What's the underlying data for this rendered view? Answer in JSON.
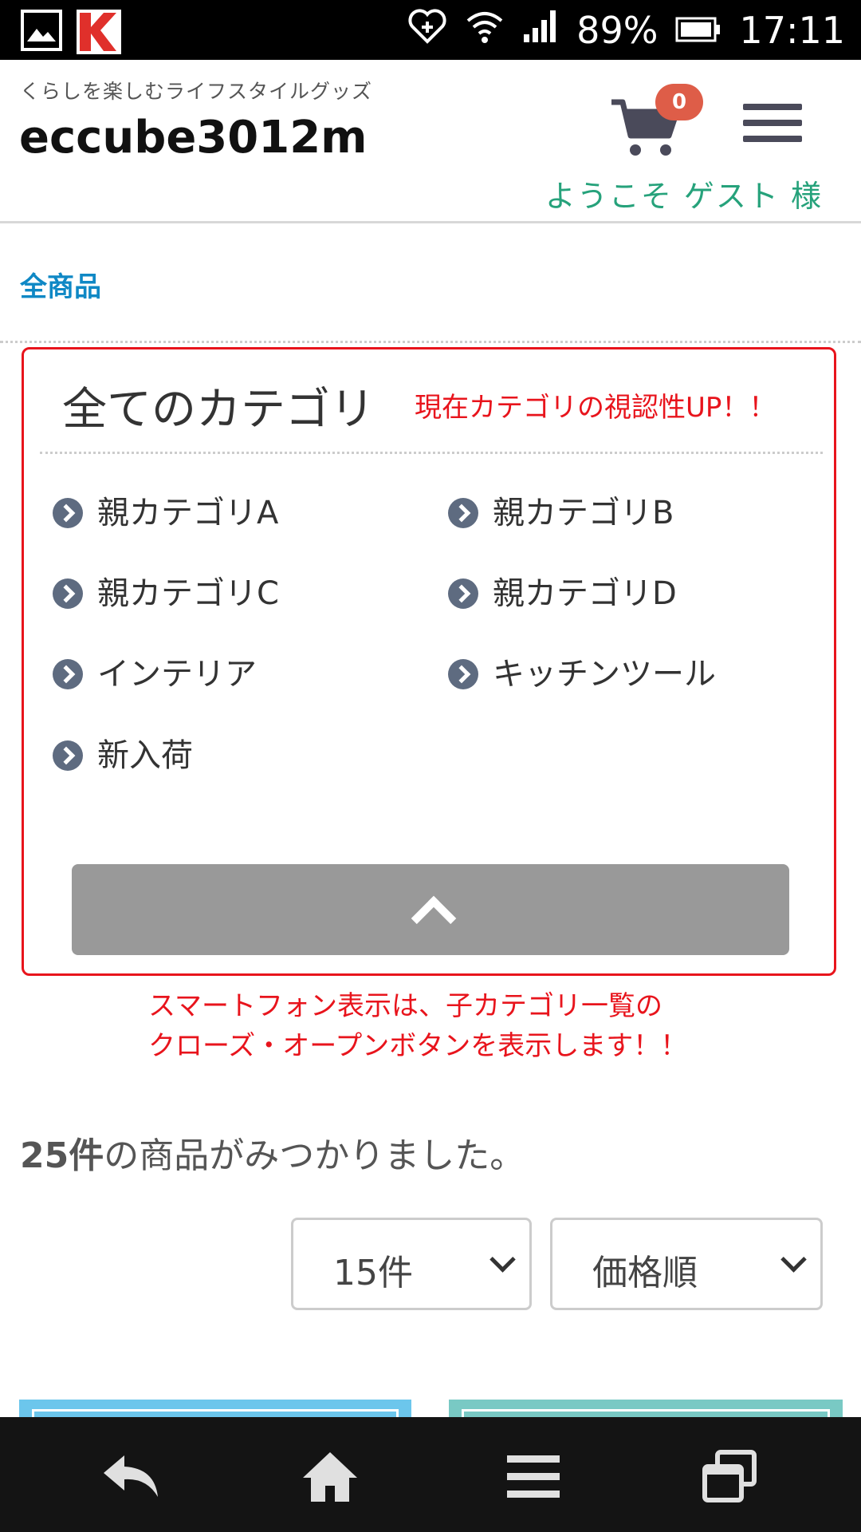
{
  "status_bar": {
    "battery_percent": "89%",
    "time": "17:11"
  },
  "header": {
    "tagline": "くらしを楽しむライフスタイルグッズ",
    "site_title": "eccube3012m",
    "cart_count": "0",
    "welcome": "ようこそ ゲスト 様"
  },
  "breadcrumb": "全商品",
  "category_box": {
    "title": "全てのカテゴリ",
    "note": "現在カテゴリの視認性UP！！",
    "items": [
      {
        "label": "親カテゴリA"
      },
      {
        "label": "親カテゴリB"
      },
      {
        "label": "親カテゴリC"
      },
      {
        "label": "親カテゴリD"
      },
      {
        "label": "インテリア"
      },
      {
        "label": "キッチンツール"
      },
      {
        "label": "新入荷"
      }
    ]
  },
  "smartphone_note": {
    "line1": "スマートフォン表示は、子カテゴリ一覧の",
    "line2": "クローズ・オープンボタンを表示します！！"
  },
  "results": {
    "count": "25件",
    "text": "の商品がみつかりました。"
  },
  "filters": {
    "per_page": "15件",
    "sort": "価格順"
  }
}
